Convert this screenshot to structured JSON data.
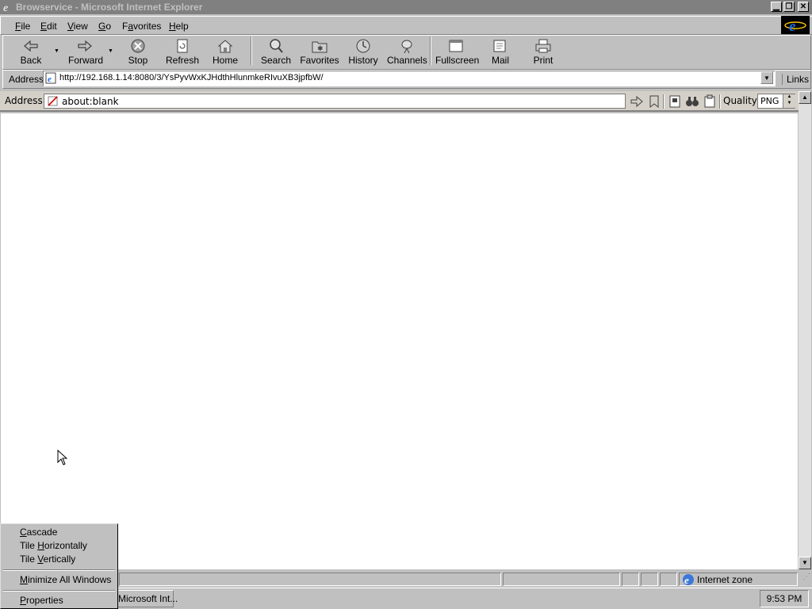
{
  "window": {
    "title": "Browservice - Microsoft Internet Explorer",
    "caption_buttons": [
      "minimize",
      "restore",
      "close"
    ]
  },
  "menu": {
    "items": [
      {
        "label": "File",
        "mnemonic": "F"
      },
      {
        "label": "Edit",
        "mnemonic": "E"
      },
      {
        "label": "View",
        "mnemonic": "V"
      },
      {
        "label": "Go",
        "mnemonic": "G"
      },
      {
        "label": "Favorites",
        "mnemonic": "a"
      },
      {
        "label": "Help",
        "mnemonic": "H"
      }
    ]
  },
  "toolbar": {
    "buttons": [
      {
        "label": "Back",
        "icon": "back-arrow-icon"
      },
      {
        "label": "Forward",
        "icon": "forward-arrow-icon"
      },
      {
        "label": "Stop",
        "icon": "stop-icon"
      },
      {
        "label": "Refresh",
        "icon": "refresh-icon"
      },
      {
        "label": "Home",
        "icon": "home-icon"
      },
      {
        "label": "Search",
        "icon": "search-icon"
      },
      {
        "label": "Favorites",
        "icon": "favorites-folder-icon"
      },
      {
        "label": "History",
        "icon": "history-icon"
      },
      {
        "label": "Channels",
        "icon": "channels-icon"
      },
      {
        "label": "Fullscreen",
        "icon": "fullscreen-icon"
      },
      {
        "label": "Mail",
        "icon": "mail-icon"
      },
      {
        "label": "Print",
        "icon": "print-icon"
      }
    ]
  },
  "address_bar": {
    "label": "Address",
    "url": "http://192.168.1.14:8080/3/YsPyvWxKJHdthHlunmkeRIvuXB3jpfbW/",
    "links_label": "Links"
  },
  "browservice_bar": {
    "address_label": "Address",
    "url": "about:blank",
    "quality_label": "Quality",
    "quality_value": "PNG"
  },
  "status_bar": {
    "zone": "Internet zone"
  },
  "taskbar": {
    "task_label": "Microsoft Int...",
    "clock": "9:53 PM"
  },
  "context_menu": {
    "items": [
      {
        "label": "Cascade",
        "mnemonic": "C"
      },
      {
        "label": "Tile Horizontally",
        "mnemonic": "H"
      },
      {
        "label": "Tile Vertically",
        "mnemonic": "V"
      },
      {
        "label": "Minimize All Windows",
        "mnemonic": "M"
      },
      {
        "label": "Properties",
        "mnemonic": "P"
      }
    ]
  },
  "colors": {
    "face": "#c0c0c0",
    "inactive_title": "#808080",
    "content_bg": "#ffffff"
  }
}
